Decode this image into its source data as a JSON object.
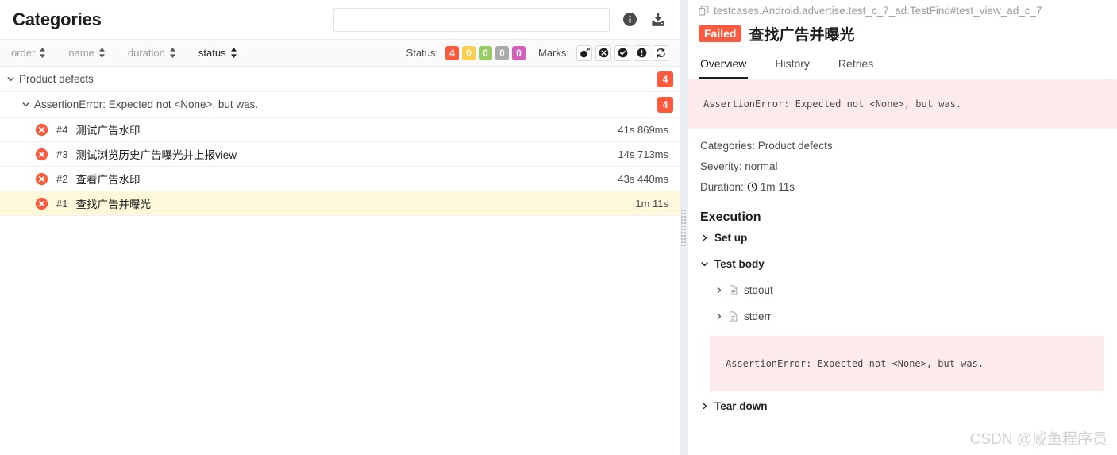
{
  "left": {
    "title": "Categories",
    "search": {
      "value": "",
      "placeholder": ""
    },
    "header_icons": [
      {
        "name": "info-icon",
        "label": "Info"
      },
      {
        "name": "download-icon",
        "label": "Download"
      }
    ],
    "columns": [
      {
        "key": "order",
        "label": "order",
        "active": false
      },
      {
        "key": "name",
        "label": "name",
        "active": false
      },
      {
        "key": "duration",
        "label": "duration",
        "active": false
      },
      {
        "key": "status",
        "label": "status",
        "active": true
      }
    ],
    "status_filter": {
      "label": "Status:",
      "chips": [
        {
          "value": "4",
          "color": "#fd5a3e",
          "name": "failed"
        },
        {
          "value": "0",
          "color": "#ffd050",
          "name": "broken"
        },
        {
          "value": "0",
          "color": "#97cc64",
          "name": "passed"
        },
        {
          "value": "0",
          "color": "#aaaaaa",
          "name": "skipped"
        },
        {
          "value": "0",
          "color": "#d35ebe",
          "name": "unknown"
        }
      ]
    },
    "marks_filter": {
      "label": "Marks:",
      "buttons": [
        {
          "name": "bomb-icon",
          "title": "Product defects"
        },
        {
          "name": "x-circle-icon",
          "title": "Test defects"
        },
        {
          "name": "check-circle-icon",
          "title": "Fixed"
        },
        {
          "name": "exclamation-circle-icon",
          "title": "Regressed"
        },
        {
          "name": "retry-icon",
          "title": "Retries"
        }
      ]
    },
    "tree": [
      {
        "level": 0,
        "type": "group",
        "expanded": true,
        "label": "Product defects",
        "count": "4"
      },
      {
        "level": 1,
        "type": "group",
        "expanded": true,
        "label": "AssertionError: Expected not <None>, but was.",
        "count": "4"
      },
      {
        "level": 2,
        "type": "test",
        "status": "failed",
        "order": "#4",
        "name": "测试广告水印",
        "duration": "41s 869ms",
        "selected": false
      },
      {
        "level": 2,
        "type": "test",
        "status": "failed",
        "order": "#3",
        "name": "测试浏览历史广告曝光并上报view",
        "duration": "14s 713ms",
        "selected": false
      },
      {
        "level": 2,
        "type": "test",
        "status": "failed",
        "order": "#2",
        "name": "查看广告水印",
        "duration": "43s 440ms",
        "selected": false
      },
      {
        "level": 2,
        "type": "test",
        "status": "failed",
        "order": "#1",
        "name": "查找广告并曝光",
        "duration": "1m 11s",
        "selected": true
      }
    ]
  },
  "right": {
    "full_name": "testcases.Android.advertise.test_c_7_ad.TestFind#test_view_ad_c_7",
    "status_badge": "Failed",
    "status_color": "#fd5a3e",
    "test_title": "查找广告并曝光",
    "tabs": [
      {
        "label": "Overview",
        "active": true
      },
      {
        "label": "History",
        "active": false
      },
      {
        "label": "Retries",
        "active": false
      }
    ],
    "error_message": "AssertionError: Expected not <None>, but was.",
    "meta": {
      "categories": "Categories: Product defects",
      "severity": "Severity: normal",
      "duration_label": "Duration:",
      "duration_value": "1m 11s"
    },
    "execution": {
      "title": "Execution",
      "steps": [
        {
          "label": "Set up",
          "expanded": false,
          "sub": false,
          "icon": null
        },
        {
          "label": "Test body",
          "expanded": true,
          "sub": false,
          "icon": null
        },
        {
          "label": "stdout",
          "expanded": false,
          "sub": true,
          "icon": "file-icon"
        },
        {
          "label": "stderr",
          "expanded": false,
          "sub": true,
          "icon": "file-icon"
        }
      ],
      "inner_error": "AssertionError: Expected not <None>, but was.",
      "teardown": {
        "label": "Tear down",
        "expanded": false
      }
    }
  },
  "watermark": "CSDN @咸鱼程序员"
}
